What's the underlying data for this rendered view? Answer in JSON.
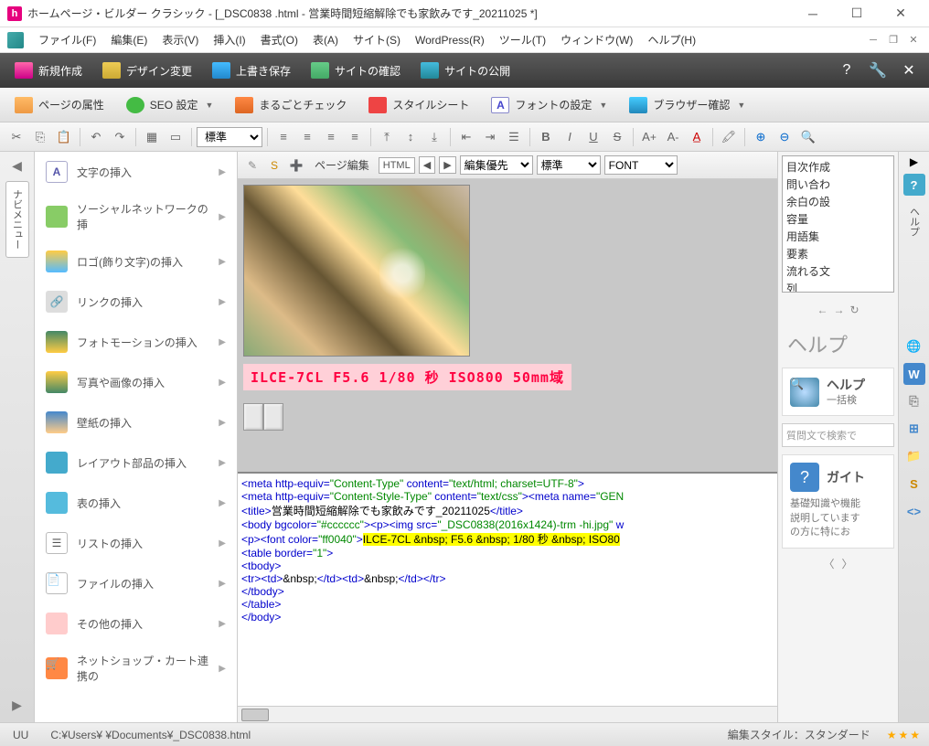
{
  "title": "ホームページ・ビルダー クラシック - [_DSC0838 .html - 営業時間短縮解除でも家飲みです_20211025 *]",
  "menu": {
    "file": "ファイル(F)",
    "edit": "編集(E)",
    "view": "表示(V)",
    "insert": "挿入(I)",
    "format": "書式(O)",
    "table": "表(A)",
    "site": "サイト(S)",
    "wordpress": "WordPress(R)",
    "tool": "ツール(T)",
    "window": "ウィンドウ(W)",
    "help": "ヘルプ(H)"
  },
  "tb1": {
    "new": "新規作成",
    "design": "デザイン変更",
    "save": "上書き保存",
    "sitecheck": "サイトの確認",
    "sitepub": "サイトの公開"
  },
  "tb2": {
    "pageprop": "ページの属性",
    "seo": "SEO 設定",
    "whole": "まるごとチェック",
    "style": "スタイルシート",
    "font": "フォントの設定",
    "browser": "ブラウザー確認"
  },
  "tb3": {
    "std": "標準"
  },
  "left": {
    "items": [
      "文字の挿入",
      "ソーシャルネットワークの挿",
      "ロゴ(飾り文字)の挿入",
      "リンクの挿入",
      "フォトモーションの挿入",
      "写真や画像の挿入",
      "壁紙の挿入",
      "レイアウト部品の挿入",
      "表の挿入",
      "リストの挿入",
      "ファイルの挿入",
      "その他の挿入",
      "ネットショップ・カート連携の"
    ],
    "navtab": "ナビメニュー"
  },
  "center": {
    "pageedit": "ページ編集",
    "html": "HTML",
    "editpri": "編集優先",
    "std": "標準",
    "font": "FONT",
    "caption": "ILCE-7CL  F5.6  1/80 秒  ISO800  50mm域"
  },
  "code": {
    "l1a": "<meta http-equiv=",
    "l1b": "\"Content-Type\"",
    "l1c": " content=",
    "l1d": "\"text/html; charset=UTF-8\"",
    "l1e": ">",
    "l2a": "<meta http-equiv=",
    "l2b": "\"Content-Style-Type\"",
    "l2c": " content=",
    "l2d": "\"text/css\"",
    "l2e": "><meta name=",
    "l2f": "\"GEN",
    "l3a": "<title>",
    "l3b": "営業時間短縮解除でも家飲みです_20211025",
    "l3c": "</title>",
    "l4a": "<body bgcolor=",
    "l4b": "\"#cccccc\"",
    "l4c": "><p><img src=",
    "l4d": "\"_DSC0838(2016x1424)-trm -hi.jpg\"",
    "l4e": " w",
    "l5a": "<p><font color=",
    "l5b": "\"ff0040\"",
    "l5c": ">",
    "l5d": "ILCE-7CL &nbsp; F5.6 &nbsp; 1/80 秒 &nbsp; ISO80",
    "l6a": "<table border=",
    "l6b": "\"1\"",
    "l6c": ">",
    "l7": "<tbody>",
    "l8a": "<tr><td>",
    "l8b": "&nbsp;",
    "l8c": "</td><td>",
    "l8d": "&nbsp;",
    "l8e": "</td></tr>",
    "l9": "</tbody>",
    "l10": "</table>",
    "l11": "</body>"
  },
  "right": {
    "list": [
      "目次作成",
      "問い合わ",
      "余白の設",
      "容量",
      "用語集",
      "要素",
      "流れる文",
      "列"
    ],
    "helptitle": "ヘルプ",
    "card1t": "ヘルプ",
    "card1s": "一括検",
    "searchph": "質問文で検索で",
    "card2t": "ガイト",
    "card2d": "基礎知識や機能\n説明しています\nの方に特にお"
  },
  "rightstrip": {
    "help": "ヘルプ"
  },
  "status": {
    "uu": "UU",
    "path": "C:¥Users¥  ¥Documents¥_DSC0838.html",
    "style": "編集スタイル：スタンダード"
  }
}
